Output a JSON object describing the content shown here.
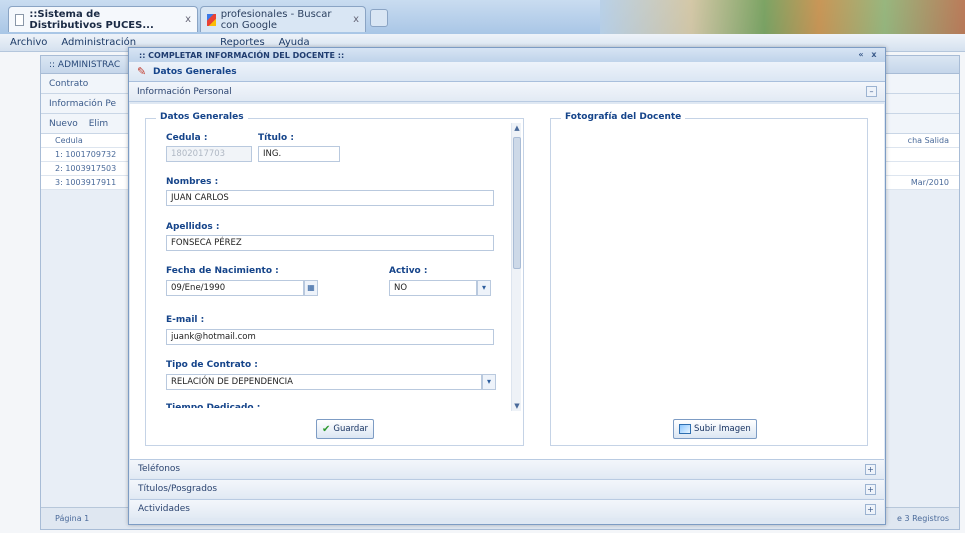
{
  "browser": {
    "tabs": [
      {
        "label": "::Sistema de Distributivos PUCES...",
        "close": "x"
      },
      {
        "label": "profesionales - Buscar con Google",
        "close": "x"
      }
    ]
  },
  "app": {
    "menu": [
      "Archivo",
      "Administración",
      "Reportes",
      "Ayuda"
    ],
    "window_title": ":: ADMINISTRAC",
    "toolbar": [
      "Contrato"
    ],
    "subtitle": "Información Pe",
    "actions": [
      "Nuevo",
      "Elim"
    ],
    "grid_header": "Cedula",
    "grid_right_header": "cha Salida",
    "rows": [
      "1: 1001709732",
      "2: 1003917503",
      "3: 1003917911"
    ],
    "row_right": "Mar/2010",
    "pager": "Página 1",
    "pager_right": "e 3 Registros"
  },
  "modal": {
    "title": ":: COMPLETAR INFORMACIÓN DEL DOCENTE ::",
    "tool_min": "«",
    "tool_close": "x",
    "section": "Datos Generales",
    "panel_header": "Información Personal",
    "collapse": "–",
    "left_legend": "Datos Generales",
    "right_legend": "Fotografía del Docente",
    "labels": {
      "cedula": "Cedula :",
      "titulo": "Título :",
      "nombres": "Nombres :",
      "apellidos": "Apellidos :",
      "fecha": "Fecha de Nacimiento :",
      "activo": "Activo :",
      "email": "E-mail :",
      "contrato": "Tipo de Contrato :",
      "tiempo": "Tiempo Dedicado :"
    },
    "values": {
      "cedula": "1802017703",
      "titulo": "ING.",
      "nombres": "JUAN CARLOS",
      "apellidos": "FONSECA PÉREZ",
      "fecha": "09/Ene/1990",
      "activo": "NO",
      "email": "juank@hotmail.com",
      "contrato": "RELACIÓN DE DEPENDENCIA"
    },
    "save_button": "Guardar",
    "upload_button": "Subir Imagen",
    "accordion": [
      "Teléfonos",
      "Títulos/Posgrados",
      "Actividades"
    ],
    "expand": "+"
  },
  "colors": {
    "accent": "#15448a",
    "frame": "#7d9cc4"
  }
}
